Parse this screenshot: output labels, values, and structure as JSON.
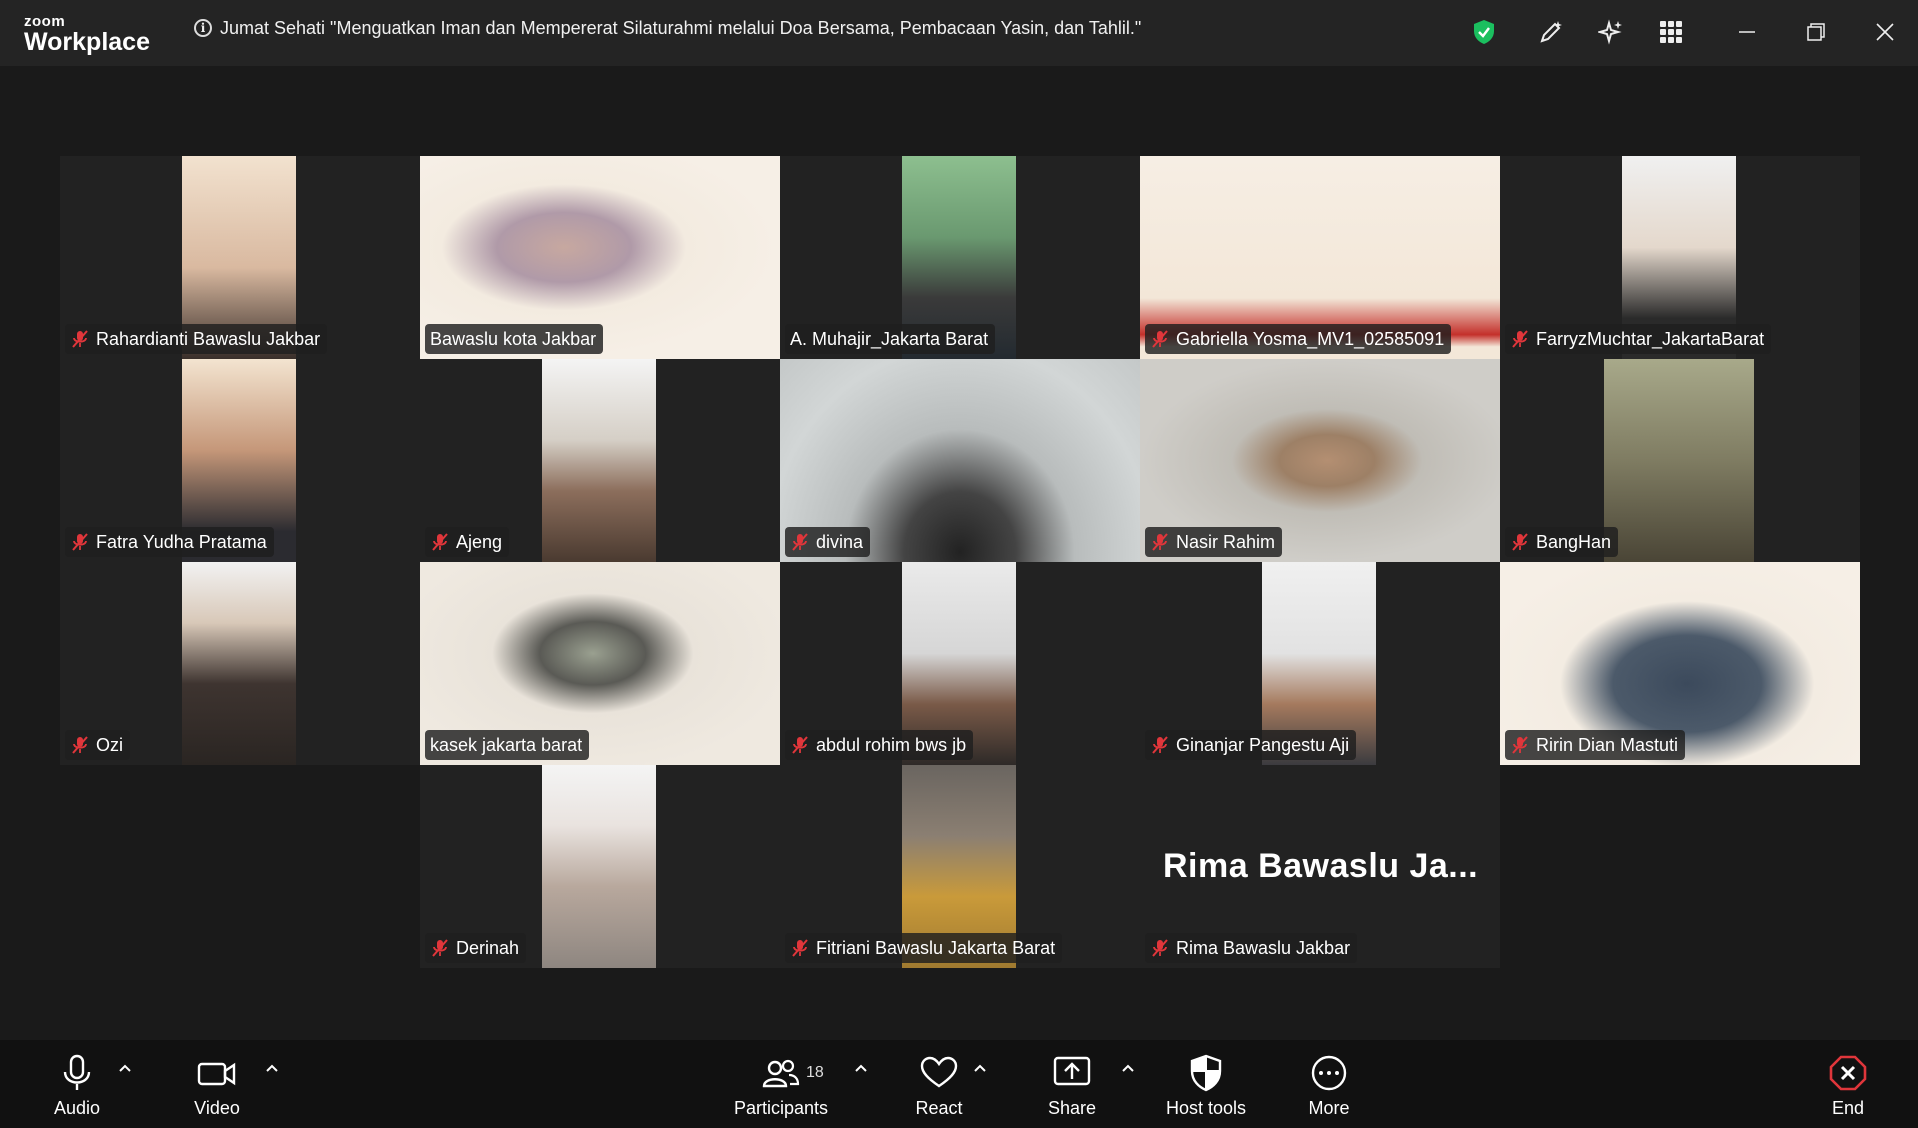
{
  "app": {
    "brand_small": "zoom",
    "brand_large": "Workplace"
  },
  "meeting": {
    "title": "Jumat Sehati \"Menguatkan Iman dan Mempererat Silaturahmi  melalui Doa Bersama, Pembacaan Yasin, dan Tahlil.\""
  },
  "colors": {
    "accent_green": "#23d18b",
    "mute_red": "#e0363b",
    "end_red": "#e0363b",
    "shield_green": "#1bbf5f"
  },
  "participants": [
    {
      "name": "Rahardianti Bawaslu Jakbar",
      "muted": true
    },
    {
      "name": "Bawaslu kota Jakbar",
      "muted": false
    },
    {
      "name": "A. Muhajir_Jakarta Barat",
      "muted": false
    },
    {
      "name": "Gabriella Yosma_MV1_02585091",
      "muted": true
    },
    {
      "name": "FarryzMuchtar_JakartaBarat",
      "muted": true
    },
    {
      "name": "Fatra Yudha Pratama",
      "muted": true
    },
    {
      "name": "Ajeng",
      "muted": true
    },
    {
      "name": "divina",
      "muted": true
    },
    {
      "name": "Nasir Rahim",
      "muted": true
    },
    {
      "name": "BangHan",
      "muted": true
    },
    {
      "name": "Ozi",
      "muted": true
    },
    {
      "name": "kasek jakarta barat",
      "muted": false,
      "active_speaker": true
    },
    {
      "name": "abdul rohim bws jb",
      "muted": true
    },
    {
      "name": "Ginanjar Pangestu Aji",
      "muted": true
    },
    {
      "name": "Ririn Dian Mastuti",
      "muted": true
    },
    {
      "name": "Derinah",
      "muted": true
    },
    {
      "name": "Fitriani Bawaslu Jakarta Barat",
      "muted": true
    },
    {
      "name": "Rima Bawaslu Jakbar",
      "muted": true,
      "video_off_label": "Rima Bawaslu Ja..."
    }
  ],
  "toolbar": {
    "audio": "Audio",
    "video": "Video",
    "participants": "Participants",
    "participants_count": "18",
    "react": "React",
    "share": "Share",
    "host_tools": "Host tools",
    "more": "More",
    "end": "End"
  }
}
